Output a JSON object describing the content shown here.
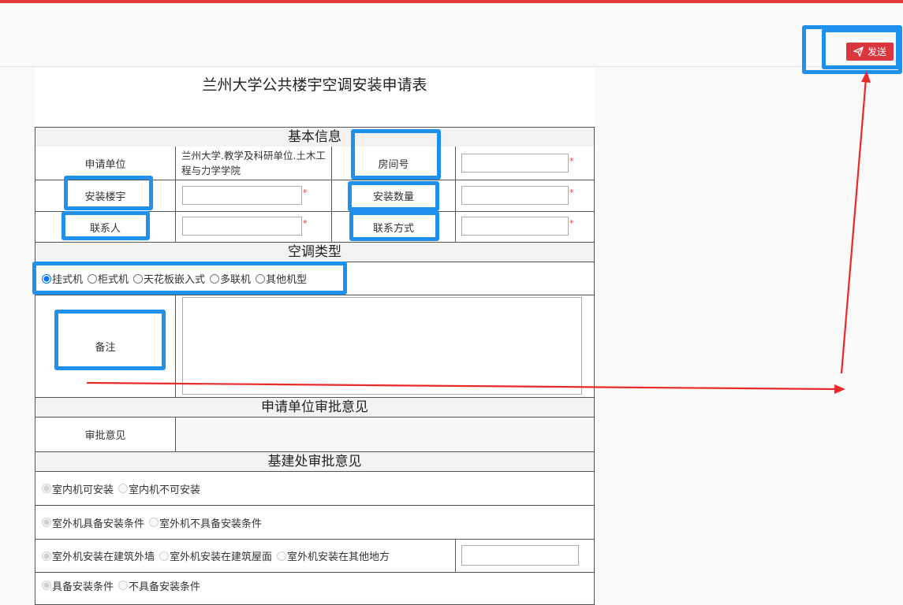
{
  "toolbar": {
    "send_label": "发送"
  },
  "form": {
    "title": "兰州大学公共楼宇空调安装申请表",
    "basic": {
      "heading": "基本信息",
      "applicant_unit_label": "申请单位",
      "applicant_unit_value": "兰州大学.教学及科研单位.土木工程与力学学院",
      "room_label": "房间号",
      "building_label": "安装楼宇",
      "quantity_label": "安装数量",
      "contact_label": "联系人",
      "contact_method_label": "联系方式",
      "required_mark": "*"
    },
    "ac_type": {
      "heading": "空调类型",
      "options": [
        "挂式机",
        "柜式机",
        "天花板嵌入式",
        "多联机",
        "其他机型"
      ]
    },
    "remarks": {
      "label": "备注"
    },
    "unit_approval": {
      "heading": "申请单位审批意见",
      "opinion_label": "审批意见"
    },
    "infra_approval": {
      "heading": "基建处审批意见",
      "row1": [
        "室内机可安装",
        "室内机不可安装"
      ],
      "row2": [
        "室外机具备安装条件",
        "室外机不具备安装条件"
      ],
      "row3": [
        "室外机安装在建筑外墙",
        "室外机安装在建筑屋面",
        "室外机安装在其他地方"
      ],
      "row4": [
        "具备安装条件",
        "不具备安装条件"
      ]
    }
  },
  "colors": {
    "accent_red": "#d9363e",
    "annotation_blue": "#1e90ee",
    "arrow_red": "#e82a2a"
  }
}
